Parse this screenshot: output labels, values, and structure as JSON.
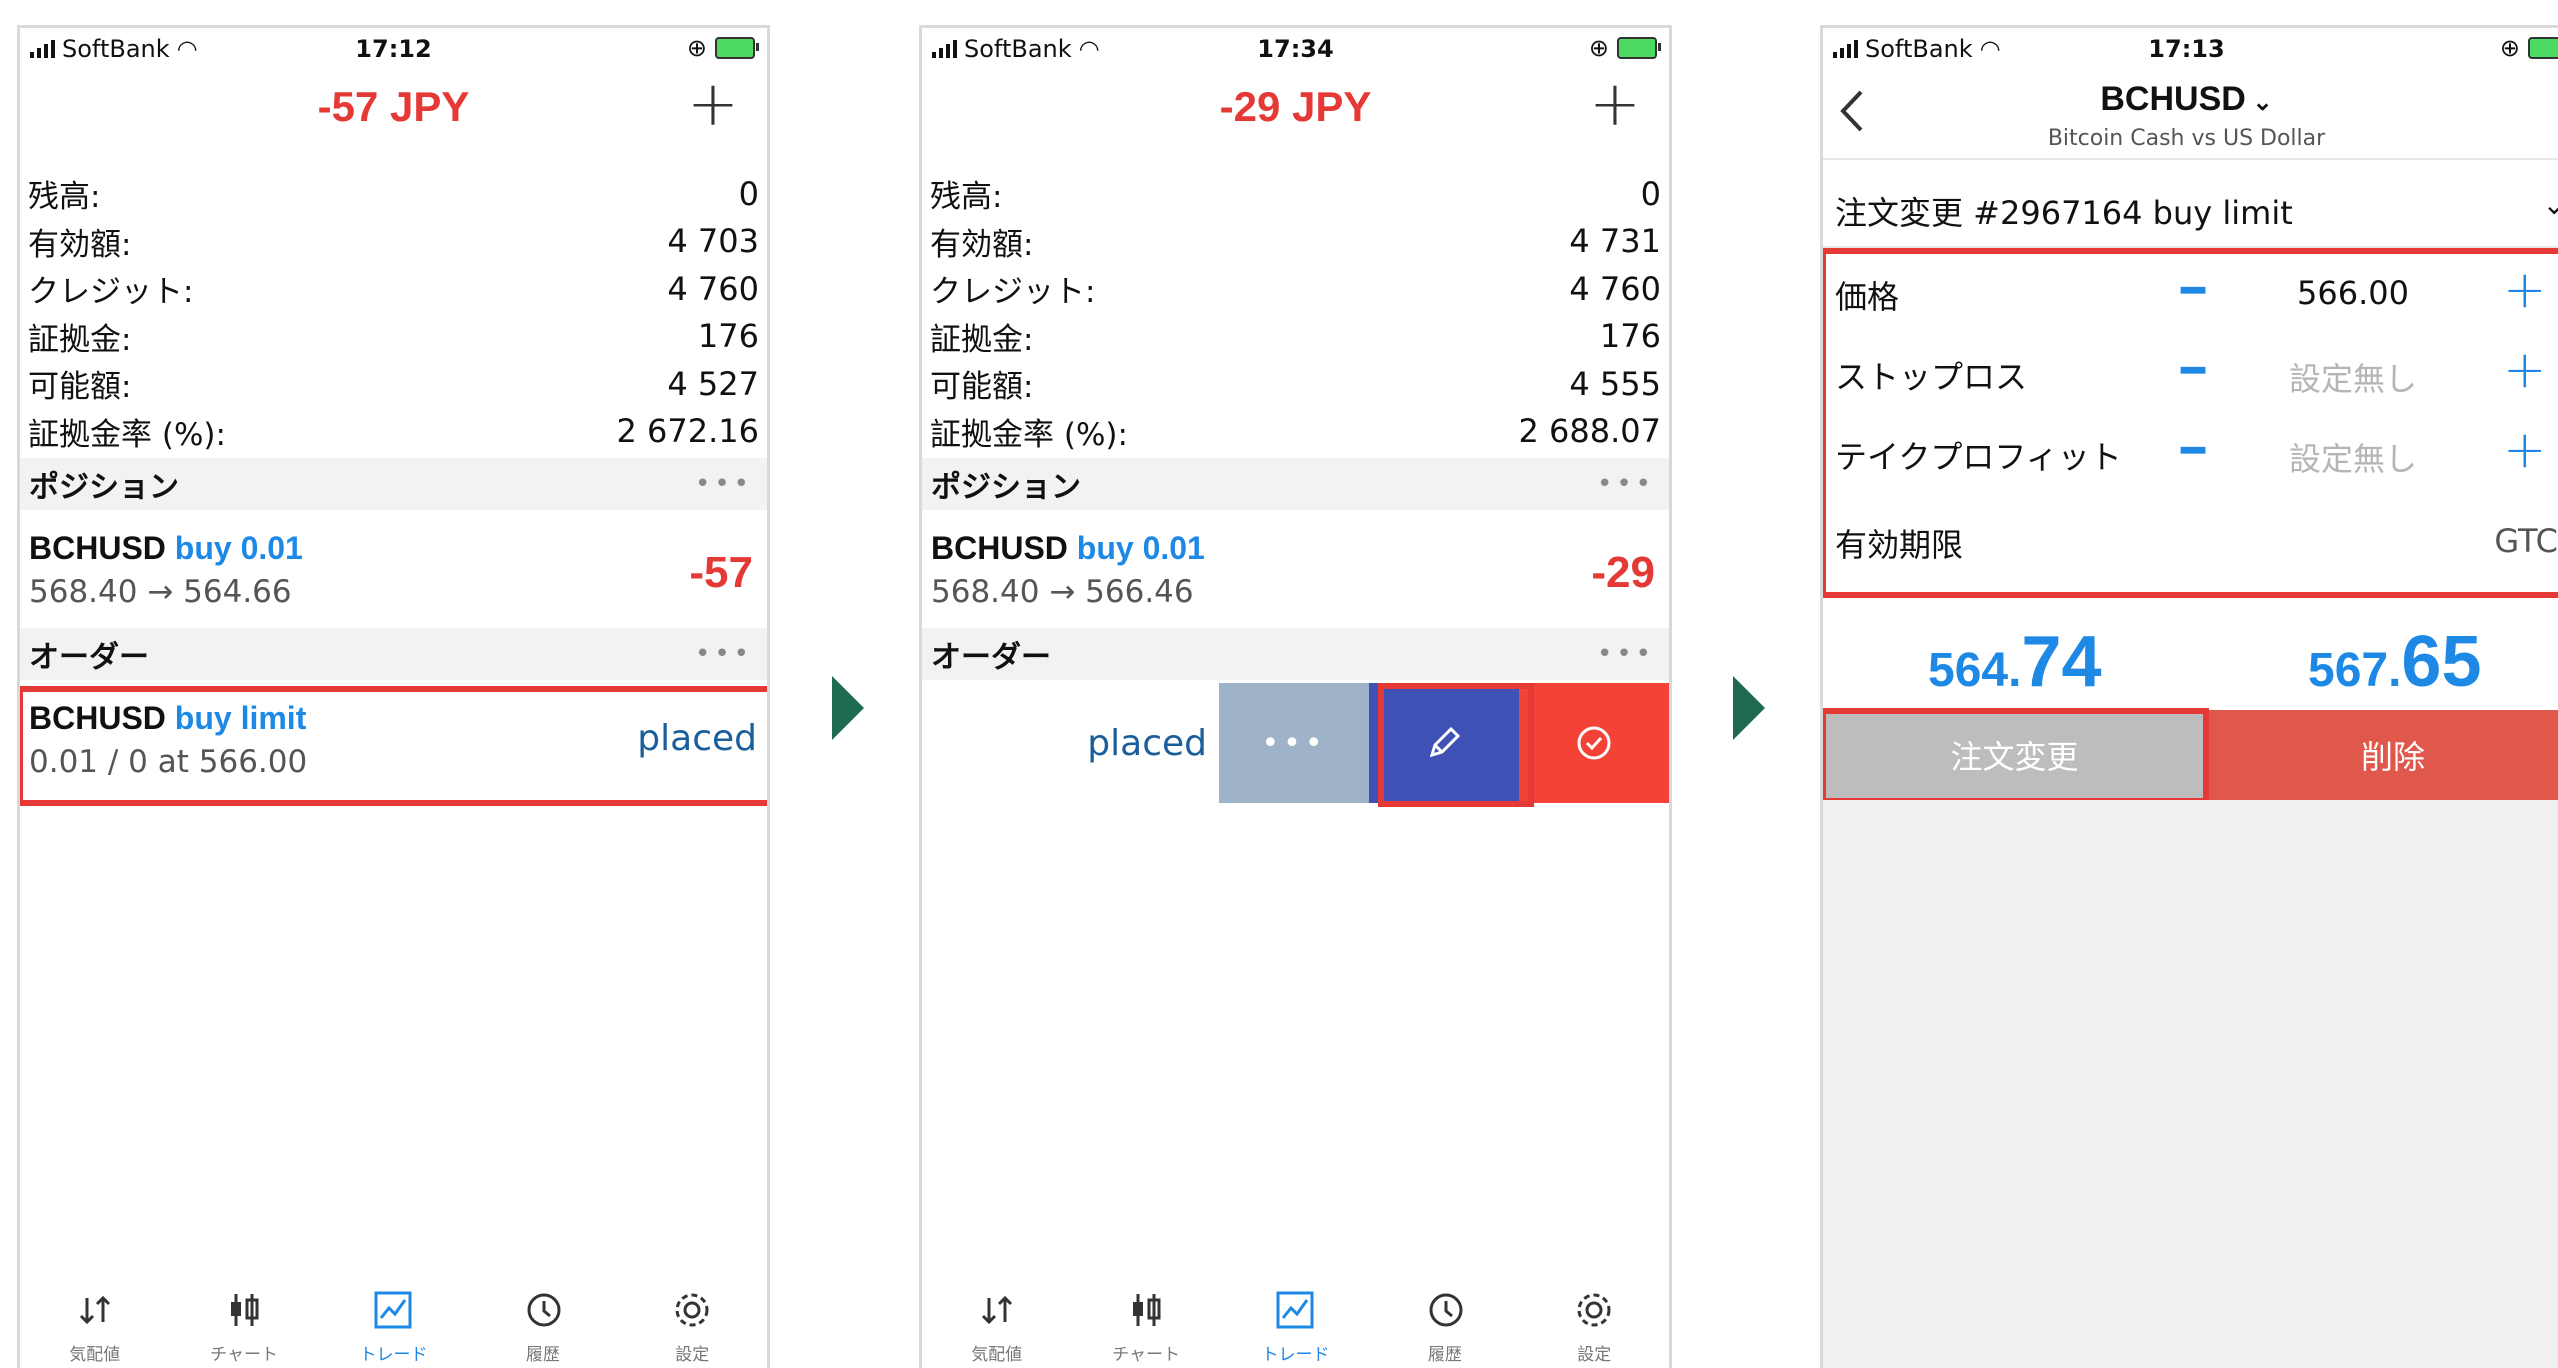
{
  "accent_blue": "#1e88e5",
  "loss_red": "#e53935",
  "highlight_red": "#e53935",
  "arrow_color": "#1e6b4f",
  "screen1": {
    "status": {
      "carrier": "SoftBank",
      "time": "17:12"
    },
    "profit": "-57 JPY",
    "account": [
      {
        "label": "残高:",
        "value": "0"
      },
      {
        "label": "有効額:",
        "value": "4 703"
      },
      {
        "label": "クレジット:",
        "value": "4 760"
      },
      {
        "label": "証拠金:",
        "value": "176"
      },
      {
        "label": "可能額:",
        "value": "4 527"
      },
      {
        "label": "証拠金率 (%):",
        "value": "2 672.16"
      }
    ],
    "positions_header": "ポジション",
    "position": {
      "symbol": "BCHUSD",
      "side": "buy 0.01",
      "prices": "568.40 → 564.66",
      "pl": "-57"
    },
    "orders_header": "オーダー",
    "order": {
      "symbol": "BCHUSD",
      "side": "buy limit",
      "details": "0.01 / 0 at 566.00",
      "status": "placed"
    },
    "tabs": [
      {
        "label": "気配値",
        "icon": "quotes-icon"
      },
      {
        "label": "チャート",
        "icon": "chart-icon"
      },
      {
        "label": "トレード",
        "icon": "trade-icon",
        "active": true
      },
      {
        "label": "履歴",
        "icon": "history-icon"
      },
      {
        "label": "設定",
        "icon": "settings-icon"
      }
    ]
  },
  "screen2": {
    "status": {
      "carrier": "SoftBank",
      "time": "17:34"
    },
    "profit": "-29 JPY",
    "account": [
      {
        "label": "残高:",
        "value": "0"
      },
      {
        "label": "有効額:",
        "value": "4 731"
      },
      {
        "label": "クレジット:",
        "value": "4 760"
      },
      {
        "label": "証拠金:",
        "value": "176"
      },
      {
        "label": "可能額:",
        "value": "4 555"
      },
      {
        "label": "証拠金率 (%):",
        "value": "2 688.07"
      }
    ],
    "positions_header": "ポジション",
    "position": {
      "symbol": "BCHUSD",
      "side": "buy 0.01",
      "prices": "568.40 → 566.46",
      "pl": "-29"
    },
    "orders_header": "オーダー",
    "order_status": "placed",
    "swipe_actions": {
      "more": "•••",
      "edit_icon": "pencil-icon",
      "confirm_icon": "check-circle-icon"
    },
    "tabs": [
      {
        "label": "気配値"
      },
      {
        "label": "チャート"
      },
      {
        "label": "トレード",
        "active": true
      },
      {
        "label": "履歴"
      },
      {
        "label": "設定"
      }
    ]
  },
  "screen3": {
    "status": {
      "carrier": "SoftBank",
      "time": "17:13"
    },
    "symbol": "BCHUSD",
    "symbol_desc": "Bitcoin Cash vs US Dollar",
    "order_type": "注文変更 #2967164 buy limit",
    "fields": [
      {
        "label": "価格",
        "value": "566.00",
        "placeholder": false
      },
      {
        "label": "ストップロス",
        "value": "設定無し",
        "placeholder": true
      },
      {
        "label": "テイクプロフィット",
        "value": "設定無し",
        "placeholder": true
      }
    ],
    "expiry": {
      "label": "有効期限",
      "value": "GTC"
    },
    "bid": {
      "prefix": "564.",
      "big": "74"
    },
    "ask": {
      "prefix": "567.",
      "big": "65"
    },
    "modify_button": "注文変更",
    "delete_button": "削除"
  }
}
